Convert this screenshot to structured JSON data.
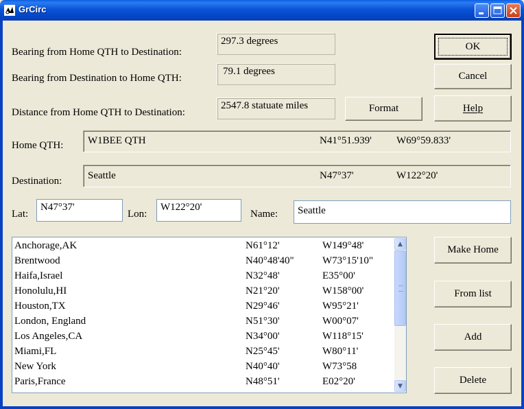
{
  "window": {
    "title": "GrCirc"
  },
  "results": {
    "bearing_home_label": "Bearing from Home QTH to Destination:",
    "bearing_home_value": "297.3 degrees",
    "bearing_dest_label": "Bearing from Destination to Home QTH:",
    "bearing_dest_value": "79.1 degrees",
    "distance_label": "Distance from Home QTH to Destination:",
    "distance_value": "2547.8 statuate miles"
  },
  "home": {
    "label": "Home QTH:",
    "name": "W1BEE QTH",
    "lat": "N41°51.939'",
    "lon": "W69°59.833'"
  },
  "destination": {
    "label": "Destination:",
    "name": "Seattle",
    "lat": "N47°37'",
    "lon": "W122°20'"
  },
  "entry": {
    "lat_label": "Lat:",
    "lat_value": "N47°37'",
    "lon_label": "Lon:",
    "lon_value": "W122°20'",
    "name_label": "Name:",
    "name_value": "Seattle"
  },
  "buttons": {
    "ok": "OK",
    "cancel": "Cancel",
    "format": "Format",
    "help": "Help",
    "make_home": "Make Home",
    "from_list": "From list",
    "add": "Add",
    "delete": "Delete"
  },
  "locations": [
    {
      "name": "Anchorage,AK",
      "lat": "N61°12'",
      "lon": "W149°48'"
    },
    {
      "name": "Brentwood",
      "lat": "N40°48'40\"",
      "lon": "W73°15'10\""
    },
    {
      "name": "Haifa,Israel",
      "lat": "N32°48'",
      "lon": "E35°00'"
    },
    {
      "name": "Honolulu,HI",
      "lat": "N21°20'",
      "lon": "W158°00'"
    },
    {
      "name": "Houston,TX",
      "lat": "N29°46'",
      "lon": "W95°21'"
    },
    {
      "name": "London, England",
      "lat": "N51°30'",
      "lon": "W00°07'"
    },
    {
      "name": "Los Angeles,CA",
      "lat": "N34°00'",
      "lon": "W118°15'"
    },
    {
      "name": "Miami,FL",
      "lat": "N25°45'",
      "lon": "W80°11'"
    },
    {
      "name": "New York",
      "lat": "N40°40'",
      "lon": "W73°58"
    },
    {
      "name": "Paris,France",
      "lat": "N48°51'",
      "lon": "E02°20'"
    }
  ],
  "icons": {
    "app": "grcirc-app-icon",
    "minimize": "minimize-icon",
    "maximize": "maximize-icon",
    "close": "close-icon",
    "scroll_up": "chevron-up-icon",
    "scroll_down": "chevron-down-icon"
  }
}
